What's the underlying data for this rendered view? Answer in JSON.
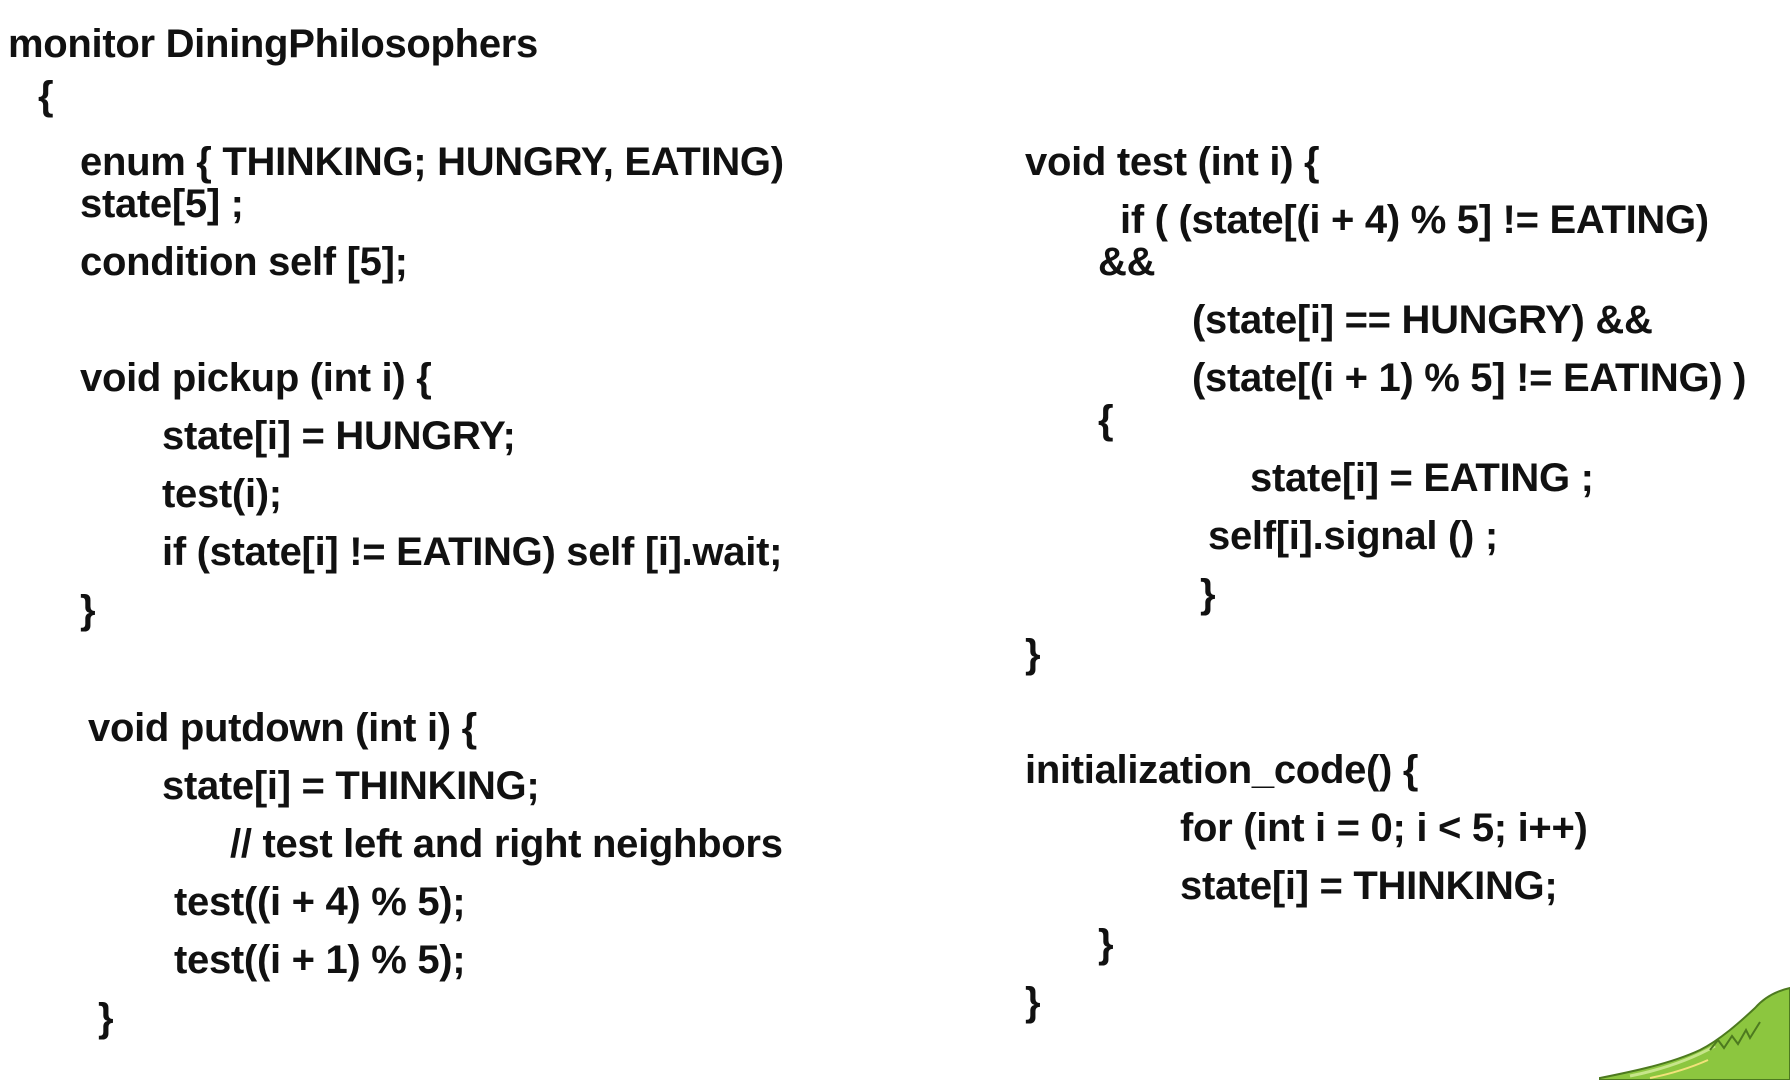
{
  "slide": {
    "left_column": [
      "monitor DiningPhilosophers",
      "{",
      "enum { THINKING; HUNGRY, EATING)",
      "state[5] ;",
      "condition self [5];",
      "void pickup (int i) {",
      "state[i] = HUNGRY;",
      "test(i);",
      "if (state[i] != EATING) self [i].wait;",
      "}",
      "void putdown (int i) {",
      "state[i] = THINKING;",
      "// test left and right neighbors",
      "test((i + 4) % 5);",
      "test((i + 1) % 5);",
      "}"
    ],
    "right_column": [
      "void test (int i) {",
      "if ( (state[(i + 4) % 5] != EATING)",
      "&&",
      "(state[i] == HUNGRY) &&",
      "(state[(i + 1) % 5] != EATING) )",
      "{",
      "state[i] = EATING ;",
      "self[i].signal () ;",
      "}",
      "}",
      "initialization_code() {",
      "for (int i = 0; i < 5; i++)",
      "state[i] = THINKING;",
      "}",
      "}"
    ],
    "accent_color": "#8cc63f"
  }
}
